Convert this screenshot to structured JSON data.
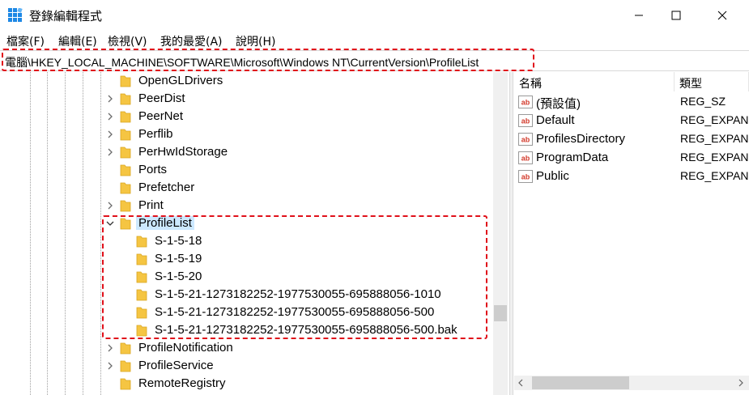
{
  "window": {
    "title": "登錄編輯程式",
    "icon": "registry-editor-icon"
  },
  "menu": [
    {
      "label": "檔案(F)"
    },
    {
      "label": "編輯(E)"
    },
    {
      "label": "檢視(V)"
    },
    {
      "label": "我的最愛(A)"
    },
    {
      "label": "說明(H)"
    }
  ],
  "address": {
    "path": "電腦\\HKEY_LOCAL_MACHINE\\SOFTWARE\\Microsoft\\Windows NT\\CurrentVersion\\ProfileList"
  },
  "tree": {
    "nodes": [
      {
        "label": "OpenGLDrivers",
        "expander": "none",
        "level": 1
      },
      {
        "label": "PeerDist",
        "expander": "collapsed",
        "level": 1
      },
      {
        "label": "PeerNet",
        "expander": "collapsed",
        "level": 1
      },
      {
        "label": "Perflib",
        "expander": "collapsed",
        "level": 1
      },
      {
        "label": "PerHwIdStorage",
        "expander": "collapsed",
        "level": 1
      },
      {
        "label": "Ports",
        "expander": "none",
        "level": 1
      },
      {
        "label": "Prefetcher",
        "expander": "none",
        "level": 1
      },
      {
        "label": "Print",
        "expander": "collapsed",
        "level": 1
      },
      {
        "label": "ProfileList",
        "expander": "expanded",
        "level": 1,
        "selected": true
      },
      {
        "label": "S-1-5-18",
        "expander": "none",
        "level": 2
      },
      {
        "label": "S-1-5-19",
        "expander": "none",
        "level": 2
      },
      {
        "label": "S-1-5-20",
        "expander": "none",
        "level": 2
      },
      {
        "label": "S-1-5-21-1273182252-1977530055-695888056-1010",
        "expander": "none",
        "level": 2
      },
      {
        "label": "S-1-5-21-1273182252-1977530055-695888056-500",
        "expander": "none",
        "level": 2
      },
      {
        "label": "S-1-5-21-1273182252-1977530055-695888056-500.bak",
        "expander": "none",
        "level": 2
      },
      {
        "label": "ProfileNotification",
        "expander": "collapsed",
        "level": 1
      },
      {
        "label": "ProfileService",
        "expander": "collapsed",
        "level": 1
      },
      {
        "label": "RemoteRegistry",
        "expander": "none",
        "level": 1
      }
    ]
  },
  "values": {
    "headers": {
      "name": "名稱",
      "type": "類型"
    },
    "rows": [
      {
        "name": "(預設值)",
        "type": "REG_SZ"
      },
      {
        "name": "Default",
        "type": "REG_EXPAN"
      },
      {
        "name": "ProfilesDirectory",
        "type": "REG_EXPAN"
      },
      {
        "name": "ProgramData",
        "type": "REG_EXPAN"
      },
      {
        "name": "Public",
        "type": "REG_EXPAN"
      }
    ]
  },
  "colors": {
    "highlight": "#e0101a",
    "selection": "#cce8ff",
    "folder": "#f5c542",
    "value_icon": "#d33b2c"
  }
}
